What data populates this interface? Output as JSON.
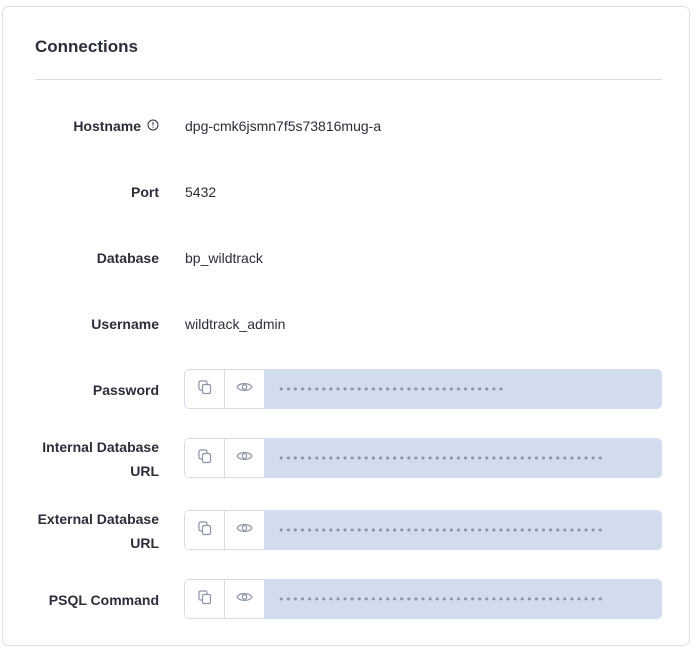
{
  "section": {
    "title": "Connections"
  },
  "fields": {
    "hostname": {
      "label": "Hostname",
      "value": "dpg-cmk6jsmn7f5s73816mug-a"
    },
    "port": {
      "label": "Port",
      "value": "5432"
    },
    "database": {
      "label": "Database",
      "value": "bp_wildtrack"
    },
    "username": {
      "label": "Username",
      "value": "wildtrack_admin"
    },
    "password": {
      "label": "Password",
      "masked": "••••••••••••••••••••••••••••••••"
    },
    "internal_url": {
      "label_line1": "Internal Database",
      "label_line2": "URL",
      "masked": "••••••••••••••••••••••••••••••••••••••••••••••"
    },
    "external_url": {
      "label_line1": "External Database",
      "label_line2": "URL",
      "masked": "••••••••••••••••••••••••••••••••••••••••••••••"
    },
    "psql_command": {
      "label": "PSQL Command",
      "masked": "••••••••••••••••••••••••••••••••••••••••••••••"
    }
  },
  "icons": {
    "info": "info-circle-icon",
    "copy": "copy-icon",
    "reveal": "eye-icon"
  },
  "colors": {
    "masked_background": "#d1dcef",
    "border": "#d7dbe6",
    "text": "#2b2e3a",
    "icon": "#8b94a8"
  }
}
